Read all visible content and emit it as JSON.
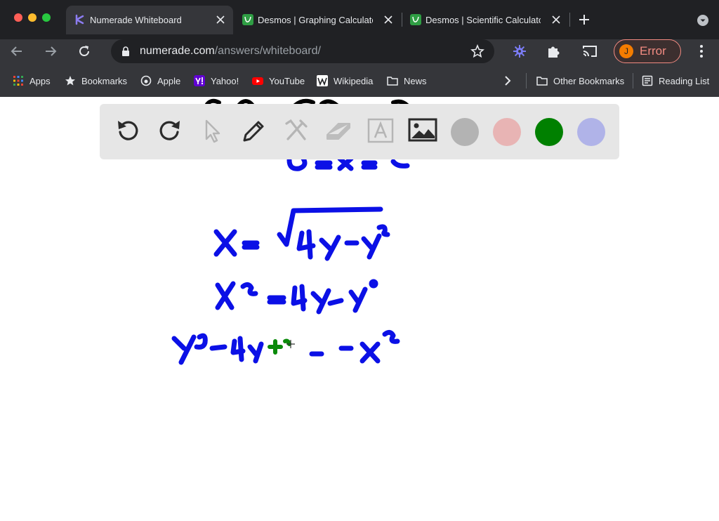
{
  "tabs": [
    {
      "label": "Numerade Whiteboard",
      "active": true,
      "favicon": "numerade-logo-icon"
    },
    {
      "label": "Desmos | Graphing Calculato",
      "active": false,
      "favicon": "desmos-logo-icon"
    },
    {
      "label": "Desmos | Scientific Calculato",
      "active": false,
      "favicon": "desmos-logo-icon"
    }
  ],
  "address_bar": {
    "domain": "numerade.com",
    "path": "/answers/whiteboard/"
  },
  "profile": {
    "initial": "J",
    "status": "Error"
  },
  "bookmarks": [
    {
      "label": "Apps",
      "icon": "apps-grid-icon"
    },
    {
      "label": "Bookmarks",
      "icon": "star-icon"
    },
    {
      "label": "Apple",
      "icon": "apple-icon"
    },
    {
      "label": "Yahoo!",
      "icon": "yahoo-icon"
    },
    {
      "label": "YouTube",
      "icon": "youtube-icon"
    },
    {
      "label": "Wikipedia",
      "icon": "wikipedia-icon"
    },
    {
      "label": "News",
      "icon": "folder-icon"
    }
  ],
  "other_bookmarks": "Other Bookmarks",
  "reading_list": "Reading List",
  "whiteboard": {
    "tools": [
      "undo",
      "redo",
      "select",
      "pen",
      "tools",
      "eraser",
      "text",
      "image"
    ],
    "colors": [
      "#b3b3b3",
      "#e8b4b4",
      "#008000",
      "#b0b3e8"
    ],
    "ink_blue": "#0b10e6",
    "ink_green": "#0a8a0a"
  }
}
